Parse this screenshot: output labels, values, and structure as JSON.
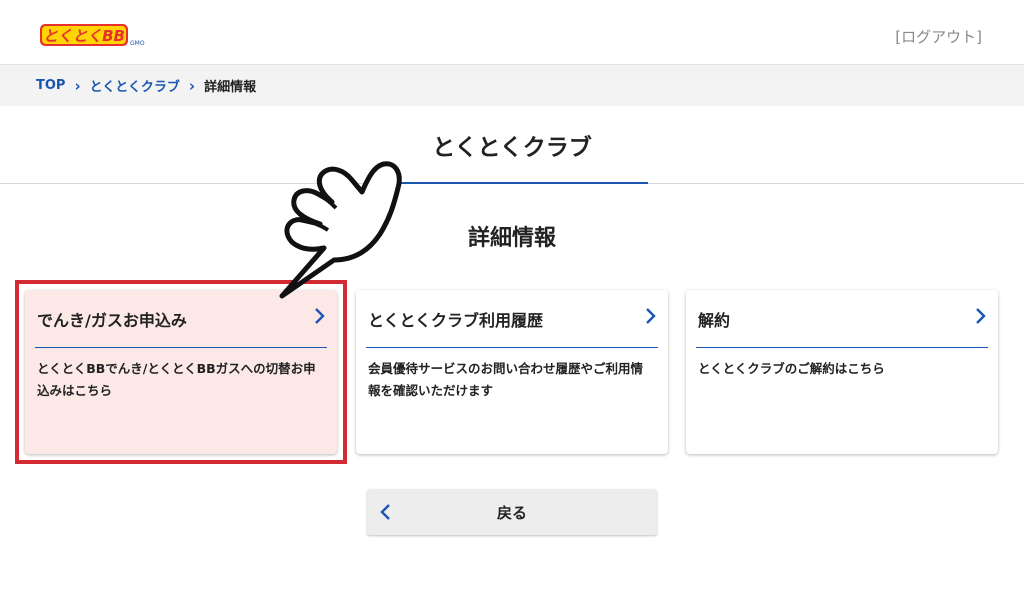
{
  "header": {
    "logo_text": "とくとくBB",
    "logo_sub": "GMO",
    "logout_label": "[ログアウト]"
  },
  "breadcrumb": {
    "items": [
      {
        "label": "TOP"
      },
      {
        "label": "とくとくクラブ"
      },
      {
        "label": "詳細情報"
      }
    ]
  },
  "page": {
    "title": "とくとくクラブ",
    "section_title": "詳細情報"
  },
  "cards": [
    {
      "title": "でんき/ガスお申込み",
      "desc": "とくとくBBでんき/とくとくBBガスへの切替お申込みはこちら"
    },
    {
      "title": "とくとくクラブ利用履歴",
      "desc": "会員優待サービスのお問い合わせ履歴やご利用情報を確認いただけます"
    },
    {
      "title": "解約",
      "desc": "とくとくクラブのご解約はこちら"
    }
  ],
  "back_button": {
    "label": "戻る"
  },
  "colors": {
    "accent": "#1a56b0",
    "highlight_frame": "#d42a33",
    "highlight_fill": "#fde8e8",
    "breadcrumb_bg": "#f3f3f3"
  },
  "icons": [
    "chevron-right-icon",
    "chevron-left-icon",
    "pointing-hand-icon"
  ]
}
